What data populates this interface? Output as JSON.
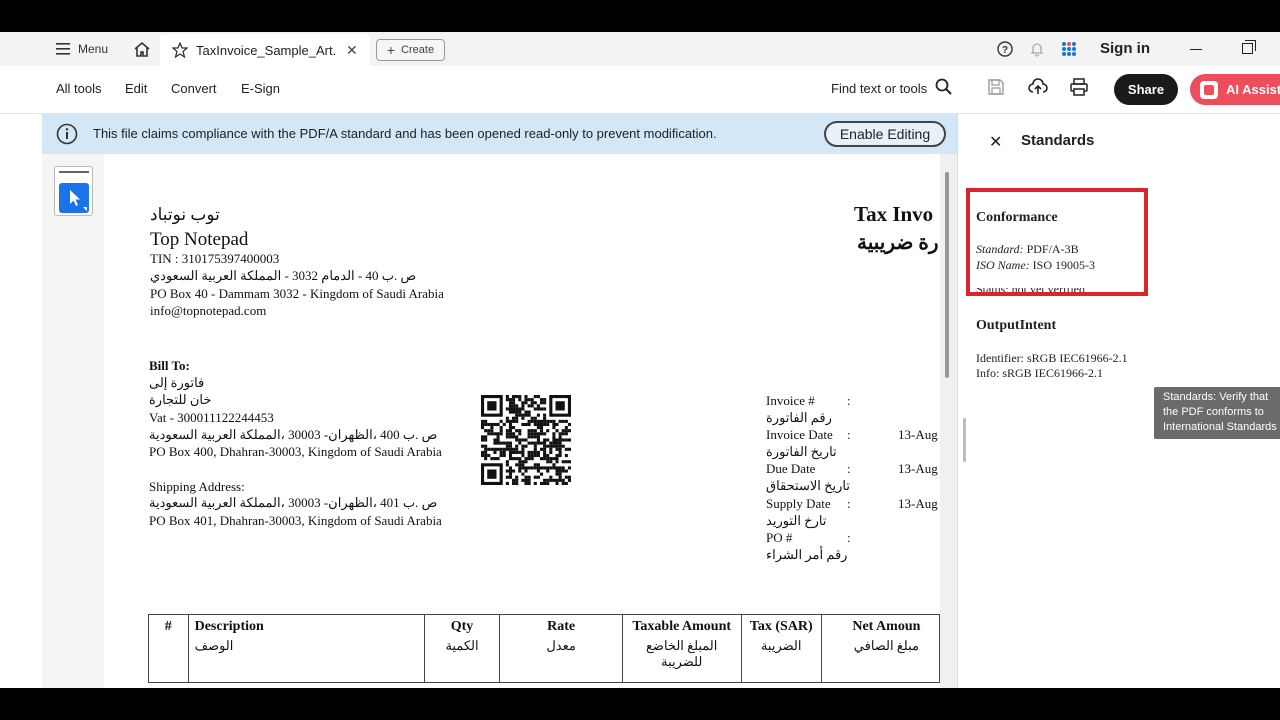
{
  "tabbar": {
    "menu_label": "Menu",
    "tab_title": "TaxInvoice_Sample_Art...",
    "create_label": "Create",
    "signin_label": "Sign in"
  },
  "toolbar": {
    "items": [
      "All tools",
      "Edit",
      "Convert",
      "E-Sign"
    ],
    "find_label": "Find text or tools",
    "share_label": "Share",
    "ai_label": "AI Assista"
  },
  "infobar": {
    "message": "This file claims compliance with the PDF/A standard and has been opened read-only to prevent modification.",
    "enable_label": "Enable Editing"
  },
  "document": {
    "company_ar": "توب نوتباد",
    "company": "Top Notepad",
    "tin": "TIN : 310175397400003",
    "address_ar": "ص .ب 40 - الدمام 3032 - المملكة العربية السعودي",
    "address": "PO Box 40 - Dammam 3032 - Kingdom of Saudi Arabia",
    "email": "info@topnotepad.com",
    "title": "Tax Invo",
    "title_ar": "رة ضريبية",
    "bill_to": "Bill To:",
    "bill_to_ar": "فاتورة إلى",
    "bill_name_ar": "خان للتجارة",
    "vat": "Vat - 300011122244453",
    "bill_addr_ar": "ص .ب 400 ،الظهران- 30003 ،المملكة العربية السعودية",
    "bill_addr": "PO Box 400, Dhahran-30003, Kingdom of Saudi Arabia",
    "ship_label": "Shipping Address:",
    "ship_addr_ar": "ص .ب 401 ،الظهران- 30003 ،المملكة العربية السعودية",
    "ship_addr": "PO Box 401, Dhahran-30003, Kingdom of Saudi Arabia",
    "meta": [
      {
        "label": "Invoice #",
        "label_ar": "رقم الفاتورة",
        "value": ""
      },
      {
        "label": "Invoice Date",
        "label_ar": "تاريخ الفاتورة",
        "value": "13-Aug"
      },
      {
        "label": "Due Date",
        "label_ar": "تاريخ الاستحقاق",
        "value": "13-Aug"
      },
      {
        "label": "Supply Date",
        "label_ar": "تارخ التوريد",
        "value": "13-Aug"
      },
      {
        "label": "PO #",
        "label_ar": "رقم أمر الشراء",
        "value": ""
      }
    ],
    "colon": ":",
    "table_headers": [
      {
        "en": "#",
        "ar": ""
      },
      {
        "en": "Description",
        "ar": "الوصف"
      },
      {
        "en": "Qty",
        "ar": "الكمية"
      },
      {
        "en": "Rate",
        "ar": "معدل"
      },
      {
        "en": "Taxable Amount",
        "ar": "المبلغ الخاضع للضريبة"
      },
      {
        "en": "Tax (SAR)",
        "ar": "الضريبة"
      },
      {
        "en": "Net Amoun",
        "ar": "مبلغ الصافي"
      }
    ]
  },
  "panel": {
    "title": "Standards",
    "conformance_heading": "Conformance",
    "standard_label": "Standard:",
    "standard_value": "PDF/A-3B",
    "iso_label": "ISO Name:",
    "iso_value": "ISO 19005-3",
    "status_text": "Status: not yet verified",
    "output_heading": "OutputIntent",
    "identifier": "Identifier: sRGB IEC61966-2.1",
    "info": "Info: sRGB IEC61966-2.1",
    "tooltip": "Standards: Verify that the PDF conforms to International Standards"
  }
}
